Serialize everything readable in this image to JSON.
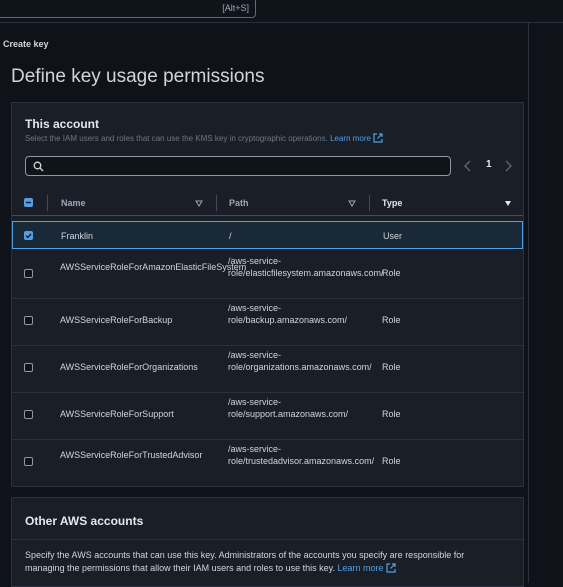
{
  "topbar": {
    "shortcut": "[Alt+S]"
  },
  "breadcrumb": "Create key",
  "page_title": "Define key usage permissions",
  "this_account": {
    "title": "This account",
    "description": "Select the IAM users and roles that can use the KMS key in cryptographic operations.",
    "learn_more": "Learn more",
    "search_placeholder": "",
    "page_number": "1",
    "columns": {
      "name": "Name",
      "path": "Path",
      "type": "Type"
    },
    "rows": [
      {
        "name": "Franklin",
        "path": "/",
        "type": "User",
        "checked": true
      },
      {
        "name": "AWSServiceRoleForAmazonElasticFileSystem",
        "path": "/aws-service-role/elasticfilesystem.amazonaws.com/",
        "type": "Role",
        "checked": false
      },
      {
        "name": "AWSServiceRoleForBackup",
        "path": "/aws-service-role/backup.amazonaws.com/",
        "type": "Role",
        "checked": false
      },
      {
        "name": "AWSServiceRoleForOrganizations",
        "path": "/aws-service-role/organizations.amazonaws.com/",
        "type": "Role",
        "checked": false
      },
      {
        "name": "AWSServiceRoleForSupport",
        "path": "/aws-service-role/support.amazonaws.com/",
        "type": "Role",
        "checked": false
      },
      {
        "name": "AWSServiceRoleForTrustedAdvisor",
        "path": "/aws-service-role/trustedadvisor.amazonaws.com/",
        "type": "Role",
        "checked": false
      }
    ]
  },
  "other_accounts": {
    "title": "Other AWS accounts",
    "description": "Specify the AWS accounts that can use this key. Administrators of the accounts you specify are responsible for managing the permissions that allow their IAM users and roles to use this key.",
    "learn_more": "Learn more"
  },
  "colors": {
    "accent": "#539fe5",
    "background": "#0f1218",
    "panel": "#1a1f27"
  }
}
